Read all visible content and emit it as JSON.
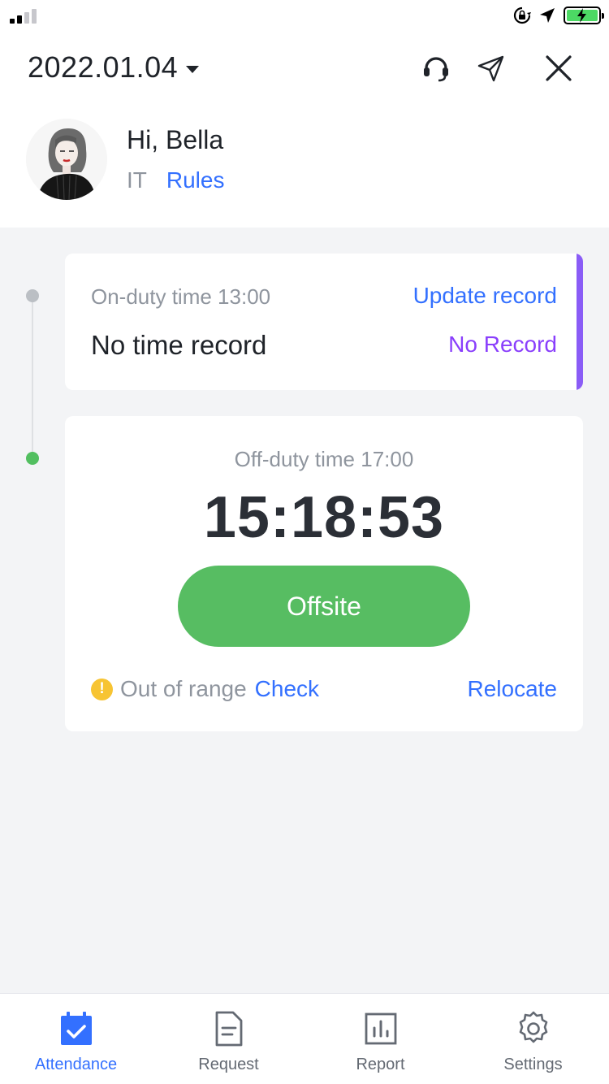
{
  "header": {
    "date": "2022.01.04",
    "greeting": "Hi, Bella",
    "department": "IT",
    "rules_link": "Rules"
  },
  "on_duty": {
    "label": "On-duty time 13:00",
    "update_link": "Update record",
    "status_text": "No time record",
    "status_tag": "No Record"
  },
  "off_duty": {
    "label": "Off-duty time 17:00",
    "clock": "15:18:53",
    "button_label": "Offsite",
    "warning_text": "Out of range",
    "check_link": "Check",
    "relocate_link": "Relocate"
  },
  "tabs": [
    {
      "label": "Attendance",
      "icon": "calendar-check-icon",
      "active": true
    },
    {
      "label": "Request",
      "icon": "document-icon",
      "active": false
    },
    {
      "label": "Report",
      "icon": "bar-chart-icon",
      "active": false
    },
    {
      "label": "Settings",
      "icon": "gear-icon",
      "active": false
    }
  ],
  "colors": {
    "accent": "#3370ff",
    "success": "#57bd62",
    "purple": "#8a5cf6",
    "warning": "#f7c433"
  }
}
